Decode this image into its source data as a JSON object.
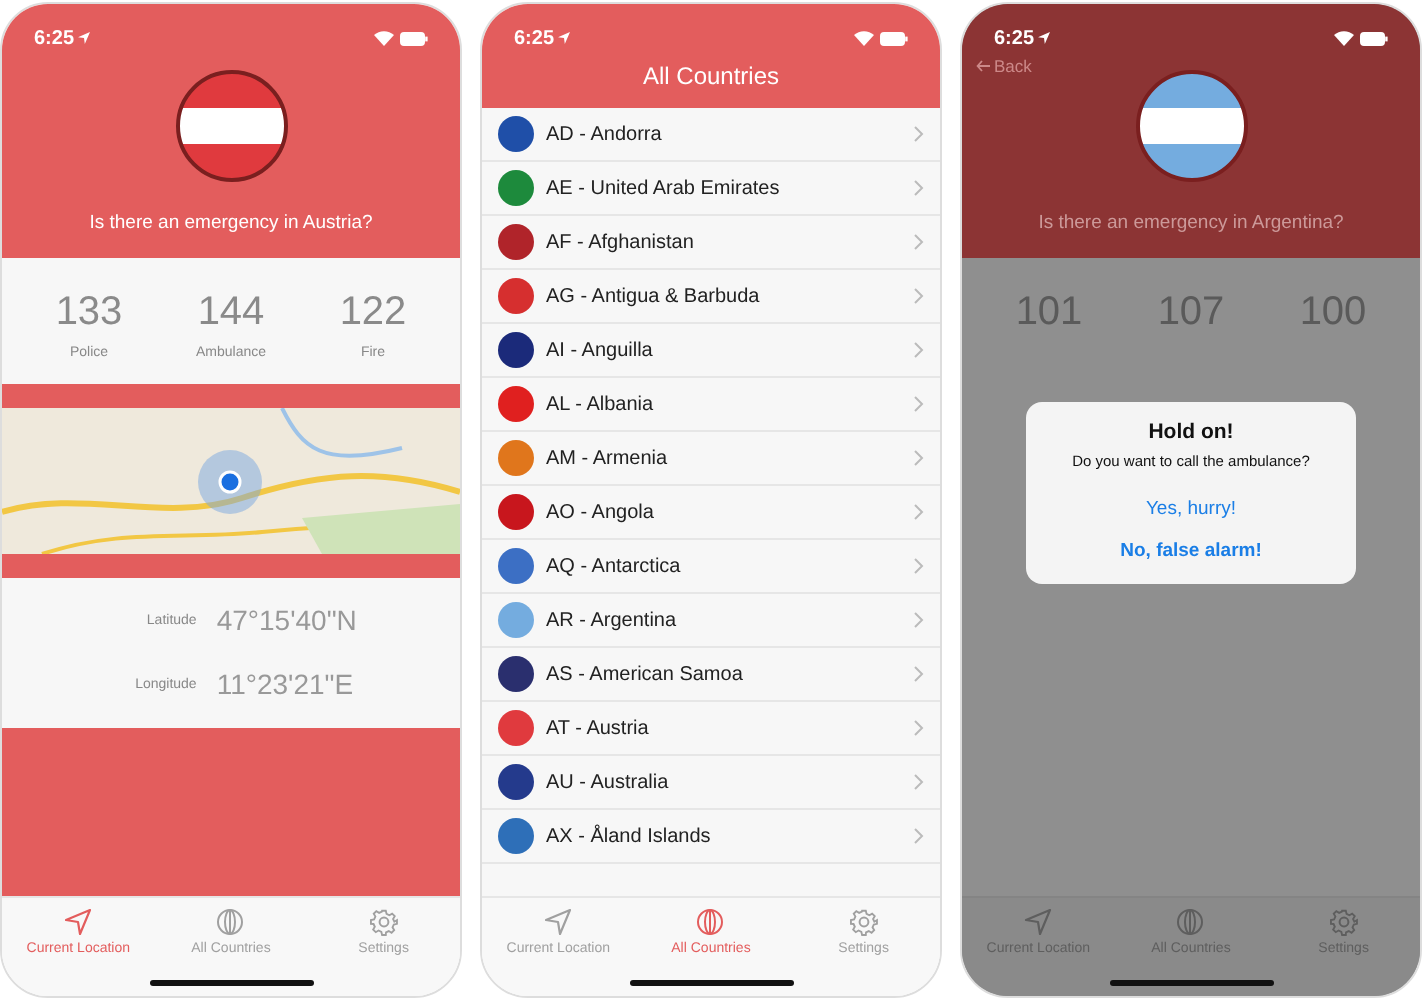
{
  "phones": [
    {
      "kind": "location",
      "dimmed": false,
      "status": {
        "time": "6:25"
      },
      "hero": {
        "color": "#e03a3e"
      },
      "question": "Is there an emergency in Austria?",
      "numbers": [
        {
          "number": "133",
          "label": "Police"
        },
        {
          "number": "144",
          "label": "Ambulance"
        },
        {
          "number": "122",
          "label": "Fire"
        }
      ],
      "coordinates": [
        {
          "label": "Latitude",
          "value": "47°15'40\"N"
        },
        {
          "label": "Longitude",
          "value": "11°23'21\"E"
        }
      ],
      "tabs": [
        {
          "kind": "location",
          "label": "Current Location",
          "selected": true
        },
        {
          "kind": "globe",
          "label": "All Countries",
          "selected": false
        },
        {
          "kind": "settings",
          "label": "Settings",
          "selected": false
        }
      ]
    },
    {
      "kind": "countries",
      "dimmed": false,
      "status": {
        "time": "6:25"
      },
      "title": "All Countries",
      "countries": [
        {
          "name": "AD - Andorra",
          "color": "#1f4fa8"
        },
        {
          "name": "AE - United Arab Emirates",
          "color": "#1d8a3c"
        },
        {
          "name": "AF - Afghanistan",
          "color": "#b0242a"
        },
        {
          "name": "AG - Antigua & Barbuda",
          "color": "#d62f2f"
        },
        {
          "name": "AI - Anguilla",
          "color": "#1b2a7a"
        },
        {
          "name": "AL - Albania",
          "color": "#e0201f"
        },
        {
          "name": "AM - Armenia",
          "color": "#e0761c"
        },
        {
          "name": "AO - Angola",
          "color": "#c8161d"
        },
        {
          "name": "AQ - Antarctica",
          "color": "#3c6fc4"
        },
        {
          "name": "AR - Argentina",
          "color": "#74acdf"
        },
        {
          "name": "AS - American Samoa",
          "color": "#2a2f6e"
        },
        {
          "name": "AT - Austria",
          "color": "#e03a3e"
        },
        {
          "name": "AU - Australia",
          "color": "#243a8c"
        },
        {
          "name": "AX - Åland Islands",
          "color": "#2e6fb8"
        }
      ],
      "tabs": [
        {
          "kind": "location",
          "label": "Current Location",
          "selected": false
        },
        {
          "kind": "globe",
          "label": "All Countries",
          "selected": true
        },
        {
          "kind": "settings",
          "label": "Settings",
          "selected": false
        }
      ]
    },
    {
      "kind": "detail",
      "dimmed": true,
      "status": {
        "time": "6:25"
      },
      "back": "Back",
      "hero": {
        "color": "#74acdf"
      },
      "question": "Is there an emergency in Argentina?",
      "numbers": [
        {
          "number": "101"
        },
        {
          "number": "107"
        },
        {
          "number": "100"
        }
      ],
      "dialog": {
        "title": "Hold on!",
        "message": "Do you want to call the ambulance?",
        "buttons": [
          {
            "label": "Yes, hurry!",
            "bold": false
          },
          {
            "label": "No, false alarm!",
            "bold": true
          }
        ]
      },
      "tabs": [
        {
          "kind": "location",
          "label": "Current Location",
          "selected": false
        },
        {
          "kind": "globe",
          "label": "All Countries",
          "selected": false
        },
        {
          "kind": "settings",
          "label": "Settings",
          "selected": false
        }
      ]
    }
  ]
}
